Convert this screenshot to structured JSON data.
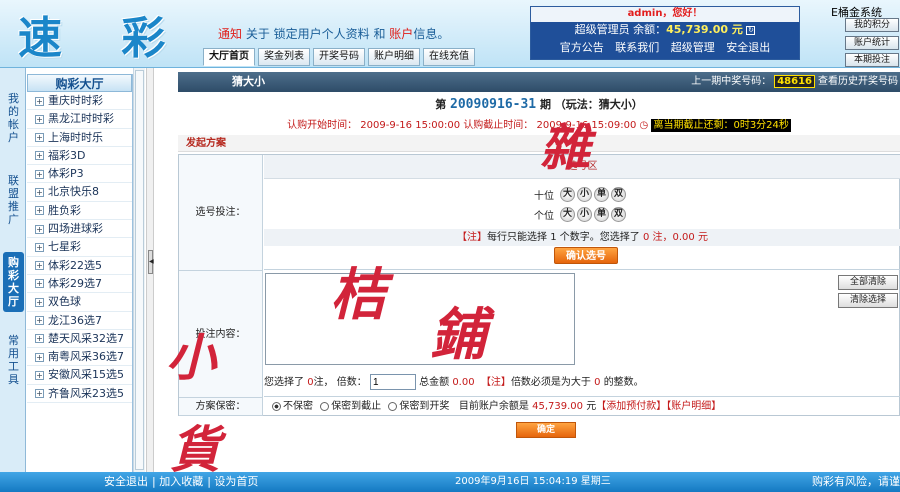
{
  "header": {
    "logo": "速 彩",
    "notice_label": "通知",
    "notice_text_1": "关于 锁定用户个人资料 和 ",
    "notice_highlight": "账户",
    "notice_text_2": "信息。",
    "tabs": [
      "大厅首页",
      "奖金列表",
      "开奖号码",
      "账户明细",
      "在线充值"
    ],
    "user_greeting": "admin，您好！",
    "user_role": "超级管理员",
    "balance_label": "余额：",
    "balance_value": "45,739.00 元",
    "user_links": [
      "官方公告",
      "联系我们",
      "超级管理",
      "安全退出"
    ],
    "right_watermark": "E桶金系统",
    "right_buttons": [
      "我的积分",
      "账户统计",
      "本期投注"
    ]
  },
  "vertical_tabs": [
    "我的帐户",
    "联盟推广",
    "购彩大厅",
    "常用工具"
  ],
  "sidebar": {
    "title": "购彩大厅",
    "items": [
      "重庆时时彩",
      "黑龙江时时彩",
      "上海时时乐",
      "福彩3D",
      "体彩P3",
      "北京快乐8",
      "胜负彩",
      "四场进球彩",
      "七星彩",
      "体彩22选5",
      "体彩29选7",
      "双色球",
      "龙江36选7",
      "楚天风采32选7",
      "南粤风采36选7",
      "安徽风采15选5",
      "齐鲁风采23选5"
    ]
  },
  "main": {
    "game_name": "猜大小",
    "last_draw_label": "上一期中奖号码：",
    "last_draw_number": "48616",
    "history_link": "查看历史开奖号码",
    "issue_prefix": "第",
    "issue_number": "20090916-31",
    "issue_suffix": "期 （玩法：猜大小）",
    "start_label": "认购开始时间：",
    "start_time": "2009-9-16 15:00:00",
    "end_label": "认购截止时间：",
    "end_time": "2009-9-16 15:09:00",
    "countdown_label": "离当期截止还剩：",
    "countdown_value": "0时3分24秒",
    "section_title": "发起方案",
    "pick_label": "选号投注：",
    "pick_area": "选号区",
    "rows": [
      {
        "label": "十位",
        "options": [
          "大",
          "小",
          "单",
          "双"
        ]
      },
      {
        "label": "个位",
        "options": [
          "大",
          "小",
          "单",
          "双"
        ]
      }
    ],
    "tip_note": "【注】",
    "tip_text": "每行只能选择 1 个数字。您选择了",
    "tip_count": "0",
    "tip_unit": "注，",
    "tip_money": "0.00",
    "tip_yuan": "元",
    "confirm_button": "确认选号",
    "content_label": "投注内容：",
    "clear_all_button": "全部清除",
    "clear_selected_button": "清除选择",
    "chosen_prefix": "您选择了",
    "chosen_count": "0",
    "chosen_unit": "注，",
    "multiple_label": "倍数：",
    "multiple_value": "1",
    "total_label": "总金额",
    "total_value": "0.00",
    "multiple_note_tag": "【注】",
    "multiple_note": "倍数必须是为大于",
    "multiple_min": "0",
    "multiple_note_end": "的整数。",
    "secret_label": "方案保密：",
    "secret_options": [
      "不保密",
      "保密到截止",
      "保密到开奖"
    ],
    "account_balance_label": "目前账户余额是",
    "account_balance_value": "45,739.00",
    "account_yuan": "元",
    "add_funds_link": "【添加预付款】",
    "account_detail_link": "【账户明细】",
    "submit_button": "确定"
  },
  "footer": {
    "links": [
      "安全退出",
      "加入收藏",
      "设为首页"
    ],
    "datetime": "2009年9月16日  15:04:19  星期三",
    "risk": "购彩有风险，请谨"
  },
  "watermark": [
    "雜",
    "桔",
    "鋪",
    "小",
    "貨"
  ],
  "colors": {
    "brand_blue": "#1b86c9",
    "accent_red": "#c41a1a",
    "button_orange": "#e5650c",
    "footer_blue": "#1479c2"
  }
}
